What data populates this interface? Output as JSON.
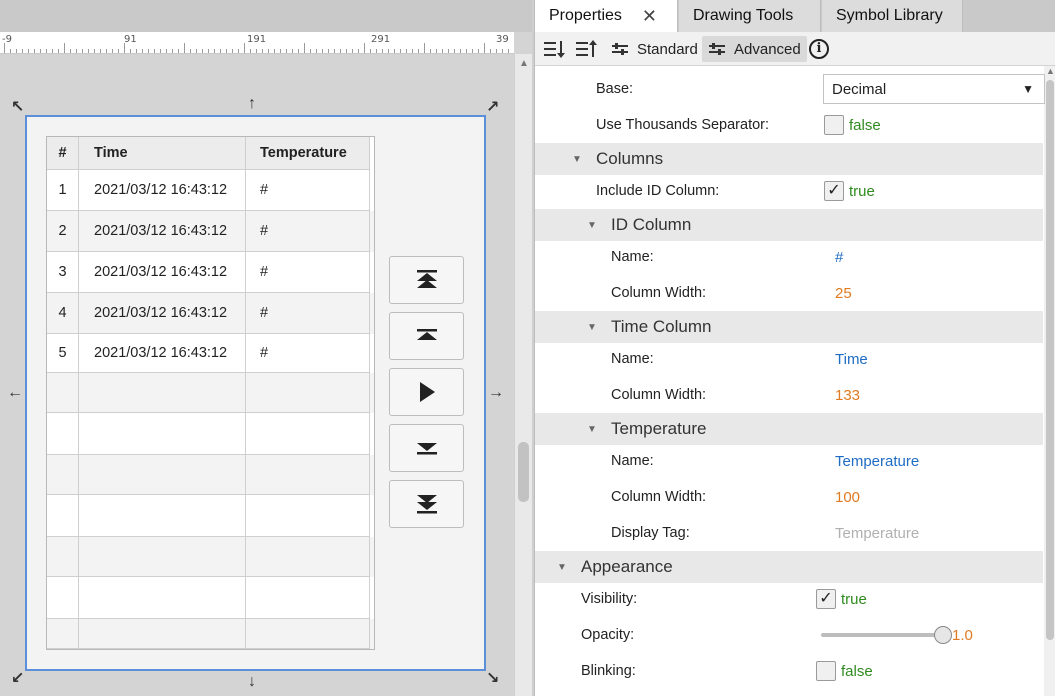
{
  "ruler": {
    "labels": [
      "-9",
      "91",
      "191",
      "291",
      "39"
    ]
  },
  "table": {
    "headers": [
      "#",
      "Time",
      "Temperature"
    ],
    "rows": [
      [
        "1",
        "2021/03/12 16:43:12",
        "#"
      ],
      [
        "2",
        "2021/03/12 16:43:12",
        "#"
      ],
      [
        "3",
        "2021/03/12 16:43:12",
        "#"
      ],
      [
        "4",
        "2021/03/12 16:43:12",
        "#"
      ],
      [
        "5",
        "2021/03/12 16:43:12",
        "#"
      ]
    ]
  },
  "nav_buttons": [
    "first-page-icon",
    "previous-page-icon",
    "play-icon",
    "next-page-icon",
    "last-page-icon"
  ],
  "tabs": {
    "properties": "Properties",
    "drawing_tools": "Drawing Tools",
    "symbol_library": "Symbol Library",
    "close_glyph": "✕"
  },
  "toolbar": {
    "standard": "Standard",
    "advanced": "Advanced",
    "info_glyph": "i"
  },
  "properties": {
    "base_label": "Base:",
    "base_value": "Decimal",
    "thousands_label": "Use Thousands Separator:",
    "thousands_value": "false",
    "columns_section": "Columns",
    "include_id_label": "Include ID Column:",
    "include_id_value": "true",
    "id_column_section": "ID Column",
    "id_name_label": "Name:",
    "id_name_value": "#",
    "id_width_label": "Column Width:",
    "id_width_value": "25",
    "time_column_section": "Time Column",
    "time_name_label": "Name:",
    "time_name_value": "Time",
    "time_width_label": "Column Width:",
    "time_width_value": "133",
    "temp_section": "Temperature",
    "temp_name_label": "Name:",
    "temp_name_value": "Temperature",
    "temp_width_label": "Column Width:",
    "temp_width_value": "100",
    "display_tag_label": "Display Tag:",
    "display_tag_placeholder": "Temperature",
    "appearance_section": "Appearance",
    "visibility_label": "Visibility:",
    "visibility_value": "true",
    "opacity_label": "Opacity:",
    "opacity_value": "1.0",
    "opacity_level": 1.0,
    "blinking_label": "Blinking:",
    "blinking_value": "false"
  },
  "colors": {
    "selection_border": "#5b8fd9",
    "value_blue": "#1f6cc4",
    "value_orange": "#e07b22",
    "value_green": "#2f8a1f"
  }
}
